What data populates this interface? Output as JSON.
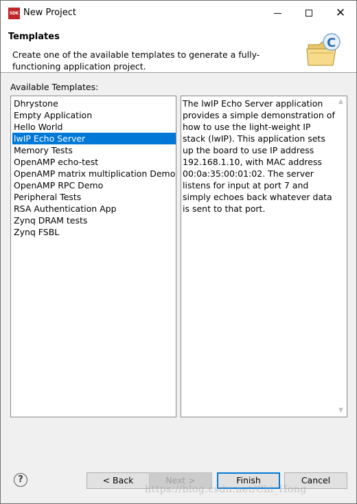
{
  "window": {
    "title": "New Project",
    "app_icon_text": "SDK"
  },
  "banner": {
    "title": "Templates",
    "description": "Create one of the available templates to generate a fully-functioning application project."
  },
  "templates": {
    "label": "Available Templates:",
    "selected_index": 3,
    "items": [
      "Dhrystone",
      "Empty Application",
      "Hello World",
      "lwIP Echo Server",
      "Memory Tests",
      "OpenAMP echo-test",
      "OpenAMP matrix multiplication Demo",
      "OpenAMP RPC Demo",
      "Peripheral Tests",
      "RSA Authentication App",
      "Zynq DRAM tests",
      "Zynq FSBL"
    ]
  },
  "description": {
    "text": "The lwIP Echo Server application provides a simple demonstration of how to use the light-weight IP stack (lwIP). This application sets up the board to use IP address 192.168.1.10, with MAC address 00:0a:35:00:01:02. The server listens for input at port 7 and simply echoes back whatever data is sent to that port."
  },
  "buttons": {
    "help": "?",
    "back": "< Back",
    "next": "Next >",
    "finish": "Finish",
    "cancel": "Cancel"
  },
  "watermark": "https://blog.csdn.net/Chi_Hong",
  "colors": {
    "selection": "#0078d7",
    "window_bg": "#f0f0f0",
    "default_button_border": "#0078d7"
  }
}
